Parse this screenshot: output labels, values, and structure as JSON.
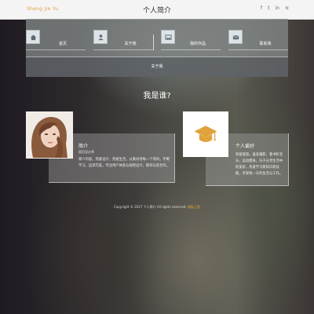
{
  "header": {
    "logo": "Sheng Jie Yu",
    "title": "个人简介",
    "social_icons": [
      "facebook-icon",
      "twitter-icon",
      "linkedin-icon",
      "rss-icon"
    ],
    "social_glyphs": [
      "f",
      "t",
      "in",
      "≋"
    ]
  },
  "nav": {
    "items": [
      {
        "label": "首页",
        "icon": "home-icon"
      },
      {
        "label": "关于我",
        "icon": "user-icon"
      },
      {
        "label": "我的作品",
        "icon": "image-icon"
      },
      {
        "label": "联系我",
        "icon": "mail-icon"
      }
    ],
    "bottom_tab": "关于我"
  },
  "section": {
    "title": "我是谁?"
  },
  "profile": {
    "name": "简介",
    "subtitle": "网页设计师",
    "text": "简介内容，热爱设计，热爱生活，认真对待每一个项目，不断学习，追求完美，专注用户体验与视觉设计，期待与您合作。"
  },
  "interests": {
    "name": "个人爱好",
    "text": "热爱旅游，喜欢摄影，看书听音乐，运动健身，乐于分享生活中的美好，热爱学习新知识新技能，享受每一天的生活与工作。"
  },
  "footer": {
    "text": "Copyright © 2017 个人简介 All rights reserved.",
    "link": "模板之家"
  },
  "colors": {
    "accent": "#e0a23a",
    "nav_bg": "#828787",
    "topbar": "#f4f4f4"
  }
}
